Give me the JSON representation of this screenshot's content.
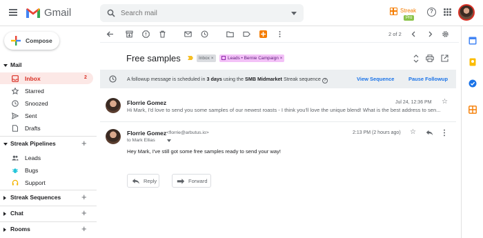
{
  "header": {
    "app_name": "Gmail",
    "search_placeholder": "Search mail",
    "streak_name": "Streak",
    "streak_plan": "Pro"
  },
  "sidebar": {
    "compose_label": "Compose",
    "mail_section": "Mail",
    "mail_items": [
      {
        "label": "Inbox",
        "count": "2",
        "icon": "inbox-icon"
      },
      {
        "label": "Starred",
        "icon": "star-icon"
      },
      {
        "label": "Snoozed",
        "icon": "clock-icon"
      },
      {
        "label": "Sent",
        "icon": "send-icon"
      },
      {
        "label": "Drafts",
        "icon": "draft-icon"
      }
    ],
    "pipelines_section": "Streak Pipelines",
    "pipeline_items": [
      {
        "label": "Leads",
        "icon": "people-icon"
      },
      {
        "label": "Bugs",
        "icon": "bug-icon"
      },
      {
        "label": "Support",
        "icon": "headset-icon"
      }
    ],
    "sequences_section": "Streak Sequences",
    "chat_section": "Chat",
    "rooms_section": "Rooms"
  },
  "toolbar": {
    "pager": "2 of 2"
  },
  "thread": {
    "subject": "Free samples",
    "labels": [
      "Inbox",
      "Leads • Bernie Campaign"
    ]
  },
  "banner": {
    "text_1": "A followup message is scheduled in ",
    "bold_1": "3 days",
    "text_2": " using the ",
    "bold_2": "SMB Midmarket",
    "text_3": " Streak sequence",
    "help": "?",
    "view_sequence": "View Sequence",
    "pause_followup": "Pause Followup"
  },
  "messages": [
    {
      "sender": "Florrie Gomez",
      "snippet": "Hi Mark, I'd love to send you some samples of our newest roasts - I think you'll love the unique blend! What is the best address to sen...",
      "date": "Jul 24, 12:36 PM"
    },
    {
      "sender": "Florrie Gomez",
      "email": "<florrie@arbutus.io>",
      "to": "to Mark Ellias",
      "date": "2:13 PM (2 hours ago)",
      "body": "Hey Mark, I've still got some free samples ready to send your way!"
    }
  ],
  "actions": {
    "reply": "Reply",
    "forward": "Forward"
  },
  "colors": {
    "gmail_red": "#d93025",
    "streak_orange": "#f57c00",
    "link_blue": "#1a73e8",
    "leads_chip": "#f3c1f7"
  }
}
